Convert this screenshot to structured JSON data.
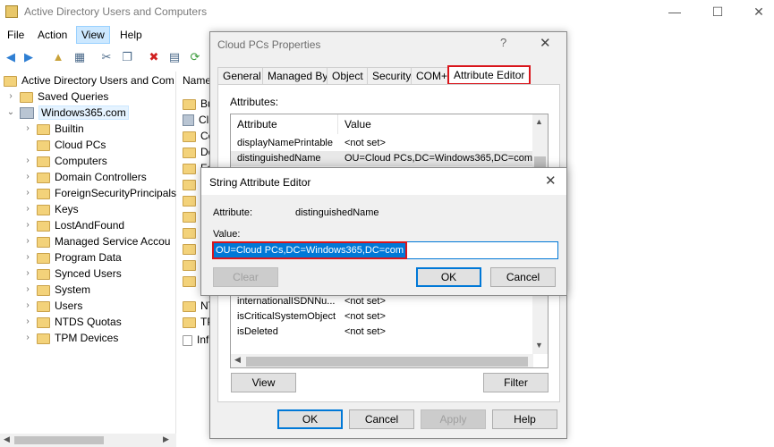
{
  "window": {
    "title": "Active Directory Users and Computers"
  },
  "menu": [
    "File",
    "Action",
    "View",
    "Help"
  ],
  "tree": {
    "root": "Active Directory Users and Com",
    "saved_queries": "Saved Queries",
    "domain": "Windows365.com",
    "children": [
      "Builtin",
      "Cloud PCs",
      "Computers",
      "Domain Controllers",
      "ForeignSecurityPrincipals",
      "Keys",
      "LostAndFound",
      "Managed Service Accou",
      "Program Data",
      "Synced Users",
      "System",
      "Users",
      "NTDS Quotas",
      "TPM Devices"
    ]
  },
  "list": {
    "header": "Name",
    "items": [
      "Bu",
      "Cl",
      "Co",
      "Do",
      "Fo",
      "K",
      "L",
      "M",
      "P",
      "S",
      "S",
      "U",
      "NT",
      "TP",
      "Inf"
    ]
  },
  "props": {
    "title": "Cloud PCs Properties",
    "help": "?",
    "tabs": [
      "General",
      "Managed By",
      "Object",
      "Security",
      "COM+",
      "Attribute Editor"
    ],
    "attributes_label": "Attributes:",
    "col_attr": "Attribute",
    "col_value": "Value",
    "rows_top": [
      {
        "name": "displayNamePrintable",
        "value": "<not set>"
      },
      {
        "name": "distinguishedName",
        "value": "OU=Cloud PCs,DC=Windows365,DC=com"
      }
    ],
    "rows_bottom": [
      {
        "name": "internationalISDNNu...",
        "value": "<not set>"
      },
      {
        "name": "isCriticalSystemObject",
        "value": "<not set>"
      },
      {
        "name": "isDeleted",
        "value": "<not set>"
      }
    ],
    "view": "View",
    "filter": "Filter",
    "ok": "OK",
    "cancel": "Cancel",
    "apply": "Apply",
    "help_btn": "Help"
  },
  "editor": {
    "title": "String Attribute Editor",
    "attribute_label": "Attribute:",
    "attribute_value": "distinguishedName",
    "value_label": "Value:",
    "value": "OU=Cloud PCs,DC=Windows365,DC=com",
    "clear": "Clear",
    "ok": "OK",
    "cancel": "Cancel"
  },
  "colors": {
    "highlight": "#d9151b",
    "selection": "#0078d7"
  }
}
